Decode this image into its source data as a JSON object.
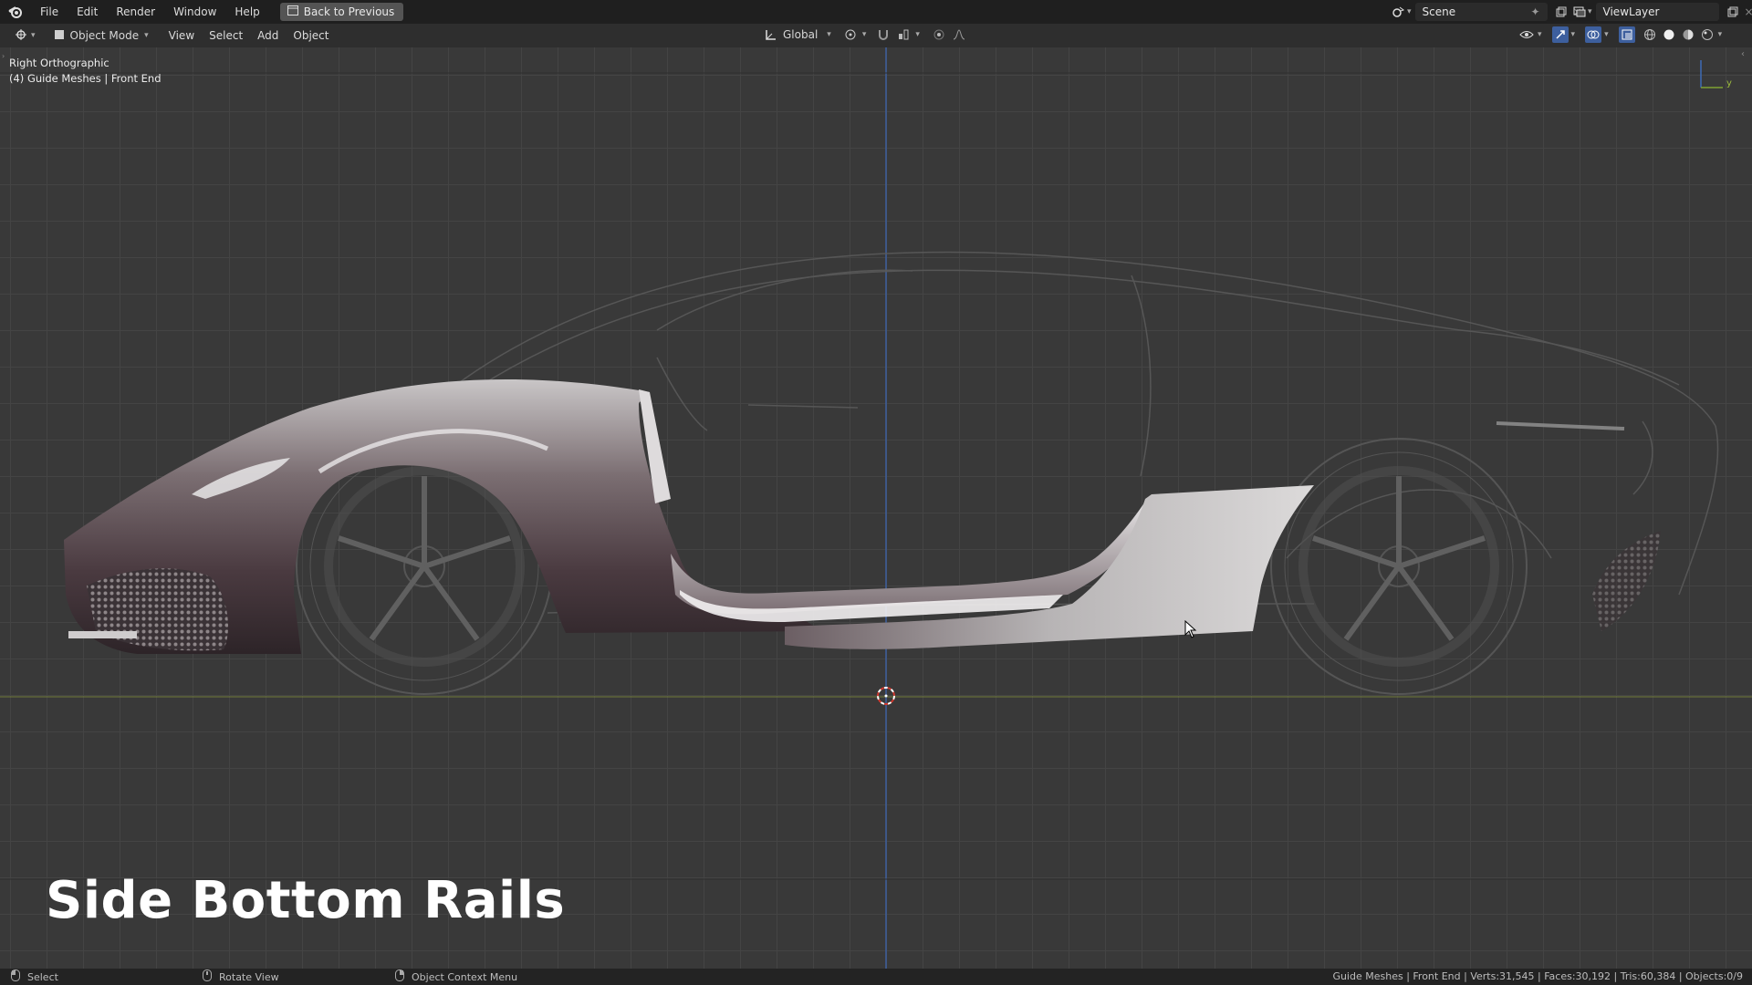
{
  "topbar": {
    "menu": [
      "File",
      "Edit",
      "Render",
      "Window",
      "Help"
    ],
    "back_button": "Back to Previous",
    "scene_label": "Scene",
    "view_layer_label": "ViewLayer"
  },
  "header": {
    "mode": "Object Mode",
    "menus": [
      "View",
      "Select",
      "Add",
      "Object"
    ],
    "orientation": "Global"
  },
  "viewport": {
    "view_name": "Right Orthographic",
    "collection_info": "(4) Guide Meshes | Front End",
    "gizmo_axis_label": "y",
    "caption": "Side Bottom Rails"
  },
  "statusbar": {
    "select": "Select",
    "rotate": "Rotate View",
    "context_menu": "Object Context Menu",
    "stats": "Guide Meshes | Front End | Verts:31,545 | Faces:30,192 | Tris:60,384 | Objects:0/9"
  },
  "colors": {
    "background": "#393939",
    "grid": "#444444",
    "z_axis": "#3d5f9e",
    "y_axis": "#8a9a2e"
  }
}
